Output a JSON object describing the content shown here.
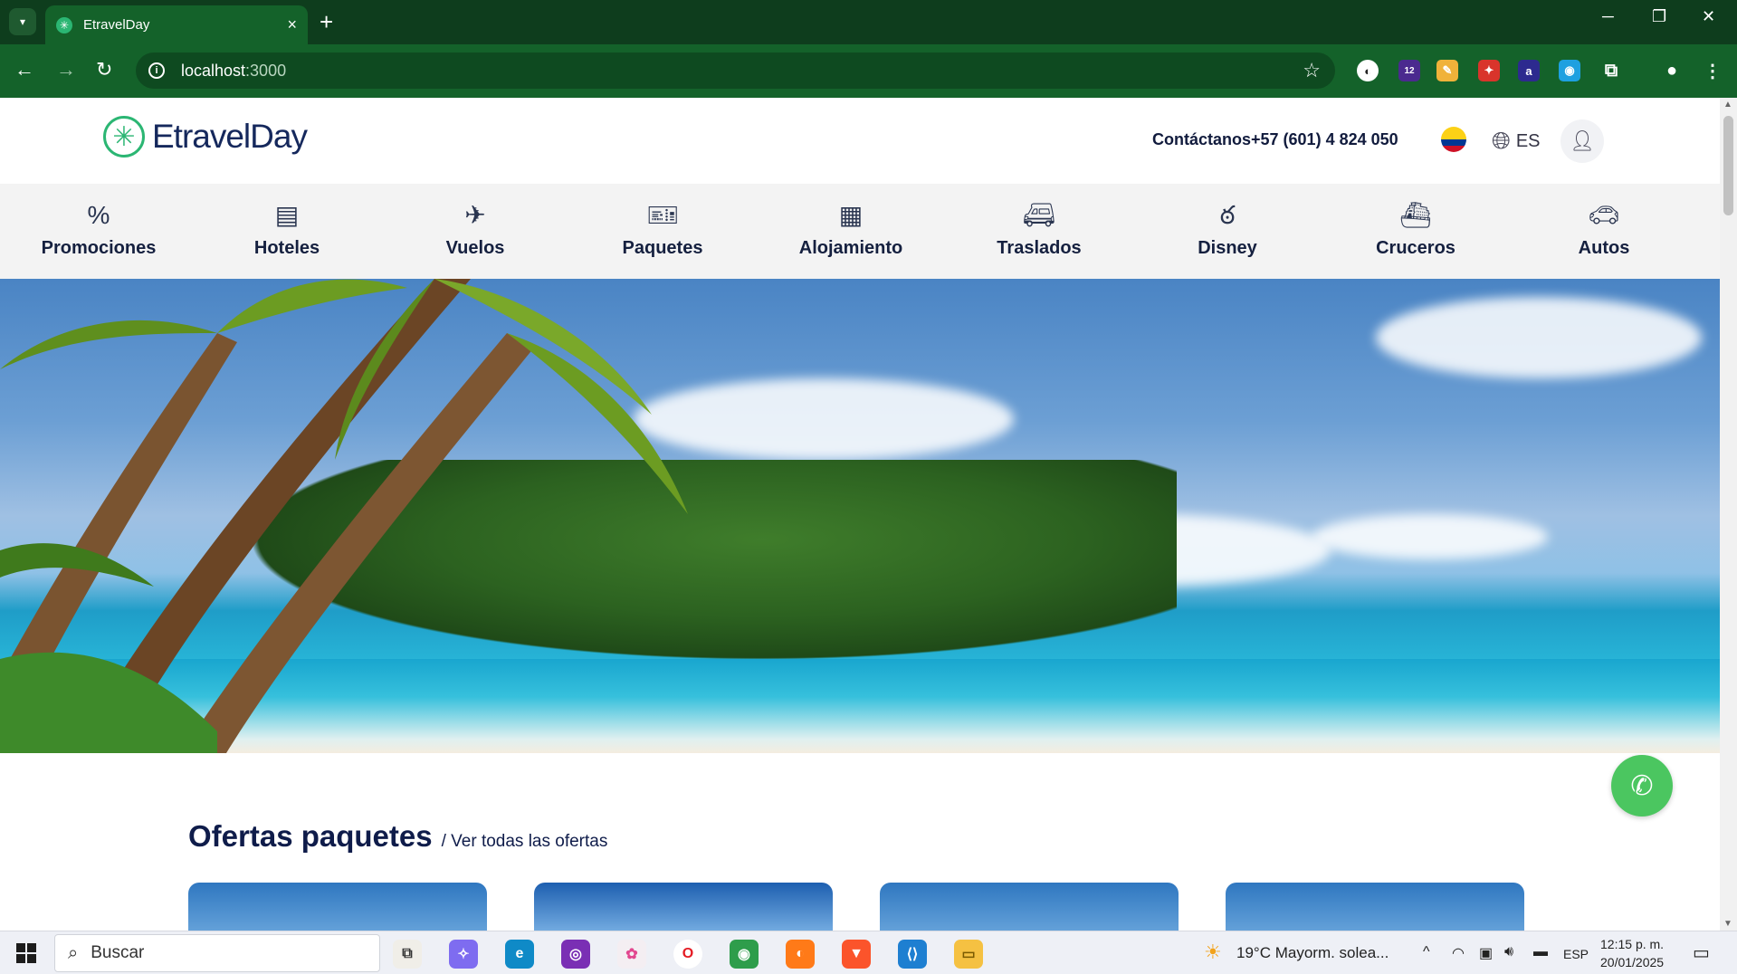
{
  "browser": {
    "tab_title": "EtravelDay",
    "address_host": "localhost",
    "address_port": ":3000",
    "extensions_badge": "12"
  },
  "header": {
    "logo_text": "EtravelDay",
    "contact": "Contáctanos+57 (601) 4 824 050",
    "language": "ES"
  },
  "categories": [
    {
      "label": "Promociones",
      "icon": "percent-badge-icon"
    },
    {
      "label": "Hoteles",
      "icon": "bed-icon"
    },
    {
      "label": "Vuelos",
      "icon": "plane-icon"
    },
    {
      "label": "Paquetes",
      "icon": "ticket-icon"
    },
    {
      "label": "Alojamiento",
      "icon": "building-icon"
    },
    {
      "label": "Traslados",
      "icon": "van-icon"
    },
    {
      "label": "Disney",
      "icon": "mouse-ears-icon"
    },
    {
      "label": "Cruceros",
      "icon": "ship-icon"
    },
    {
      "label": "Autos",
      "icon": "car-icon"
    }
  ],
  "offers": {
    "title": "Ofertas paquetes",
    "link": "/ Ver todas las ofertas"
  },
  "taskbar": {
    "search_placeholder": "Buscar",
    "weather": "19°C  Mayorm. solea...",
    "lang": "ESP",
    "time": "12:15 p. m.",
    "date": "20/01/2025"
  }
}
